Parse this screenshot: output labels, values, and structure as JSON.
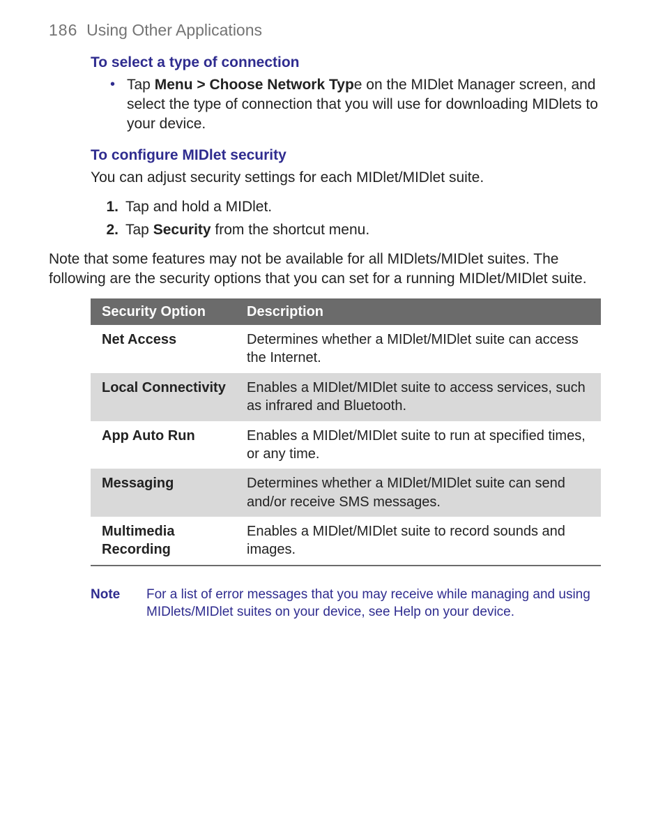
{
  "header": {
    "page_num": "186",
    "title": "Using Other Applications"
  },
  "sec1": {
    "title": "To select a type of connection",
    "bullet_pre": "Tap ",
    "bullet_bold": "Menu > Choose Network Typ",
    "bullet_post": "e on the MIDlet Manager screen, and select the type of connection that you will use for downloading MIDlets to your device."
  },
  "sec2": {
    "title": "To configure MIDlet security",
    "intro": "You can adjust security settings for each MIDlet/MIDlet suite.",
    "steps": [
      {
        "num": "1.",
        "pre": "Tap and hold a MIDlet.",
        "bold": "",
        "post": ""
      },
      {
        "num": "2.",
        "pre": "Tap ",
        "bold": "Security",
        "post": " from the shortcut menu."
      }
    ],
    "after": "Note that some features may not be available for all MIDlets/MIDlet suites. The following are the security options that you can set for a running MIDlet/MIDlet suite."
  },
  "table": {
    "h1": "Security Option",
    "h2": "Description",
    "rows": [
      {
        "opt": "Net Access",
        "desc": "Determines whether a MIDlet/MIDlet suite can access the Internet."
      },
      {
        "opt": "Local Connectivity",
        "desc": "Enables a MIDlet/MIDlet suite to access services, such as infrared and Bluetooth."
      },
      {
        "opt": "App Auto Run",
        "desc": "Enables a MIDlet/MIDlet suite to run at specified times, or any time."
      },
      {
        "opt": "Messaging",
        "desc": "Determines whether a MIDlet/MIDlet suite can send and/or receive SMS messages."
      },
      {
        "opt": "Multimedia Recording",
        "desc": "Enables a MIDlet/MIDlet suite to record sounds and images."
      }
    ]
  },
  "note": {
    "label": "Note",
    "text": "For a list of error messages that you may receive while managing and using MIDlets/MIDlet suites on your device, see Help on your device."
  }
}
